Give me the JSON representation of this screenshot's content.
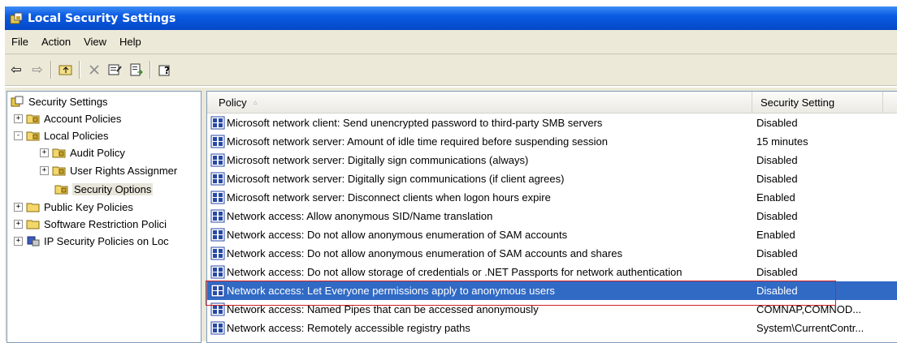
{
  "window": {
    "title": "Local Security Settings"
  },
  "menu": {
    "items": [
      "File",
      "Action",
      "View",
      "Help"
    ]
  },
  "toolbar": {
    "buttons": [
      "back",
      "forward",
      "up-folder",
      "delete",
      "properties",
      "export-list",
      "help"
    ]
  },
  "tree": {
    "root": "Security Settings",
    "nodes": [
      {
        "label": "Account Policies",
        "expander": "+"
      },
      {
        "label": "Local Policies",
        "expander": "-"
      },
      {
        "label": "Audit Policy",
        "expander": "+"
      },
      {
        "label": "User Rights Assignmer",
        "expander": "+"
      },
      {
        "label": "Security Options",
        "expander": ""
      },
      {
        "label": "Public Key Policies",
        "expander": "+"
      },
      {
        "label": "Software Restriction Polici",
        "expander": "+"
      },
      {
        "label": "IP Security Policies on Loc",
        "expander": "+"
      }
    ]
  },
  "list": {
    "columns": {
      "policy": "Policy",
      "setting": "Security Setting"
    },
    "rows": [
      {
        "policy": "Microsoft network client: Send unencrypted password to third-party SMB servers",
        "setting": "Disabled"
      },
      {
        "policy": "Microsoft network server: Amount of idle time required before suspending session",
        "setting": "15 minutes"
      },
      {
        "policy": "Microsoft network server: Digitally sign communications (always)",
        "setting": "Disabled"
      },
      {
        "policy": "Microsoft network server: Digitally sign communications (if client agrees)",
        "setting": "Disabled"
      },
      {
        "policy": "Microsoft network server: Disconnect clients when logon hours expire",
        "setting": "Enabled"
      },
      {
        "policy": "Network access: Allow anonymous SID/Name translation",
        "setting": "Disabled"
      },
      {
        "policy": "Network access: Do not allow anonymous enumeration of SAM accounts",
        "setting": "Enabled"
      },
      {
        "policy": "Network access: Do not allow anonymous enumeration of SAM accounts and shares",
        "setting": "Disabled"
      },
      {
        "policy": "Network access: Do not allow storage of credentials or .NET Passports for network authentication",
        "setting": "Disabled"
      },
      {
        "policy": "Network access: Let Everyone permissions apply to anonymous users",
        "setting": "Disabled"
      },
      {
        "policy": "Network access: Named Pipes that can be accessed anonymously",
        "setting": "COMNAP,COMNOD..."
      },
      {
        "policy": "Network access: Remotely accessible registry paths",
        "setting": "System\\CurrentContr..."
      }
    ],
    "selected_index": 9
  },
  "colors": {
    "selection": "#316ac5",
    "highlight_box": "#d02020",
    "titlebar": "#0a5be2"
  }
}
